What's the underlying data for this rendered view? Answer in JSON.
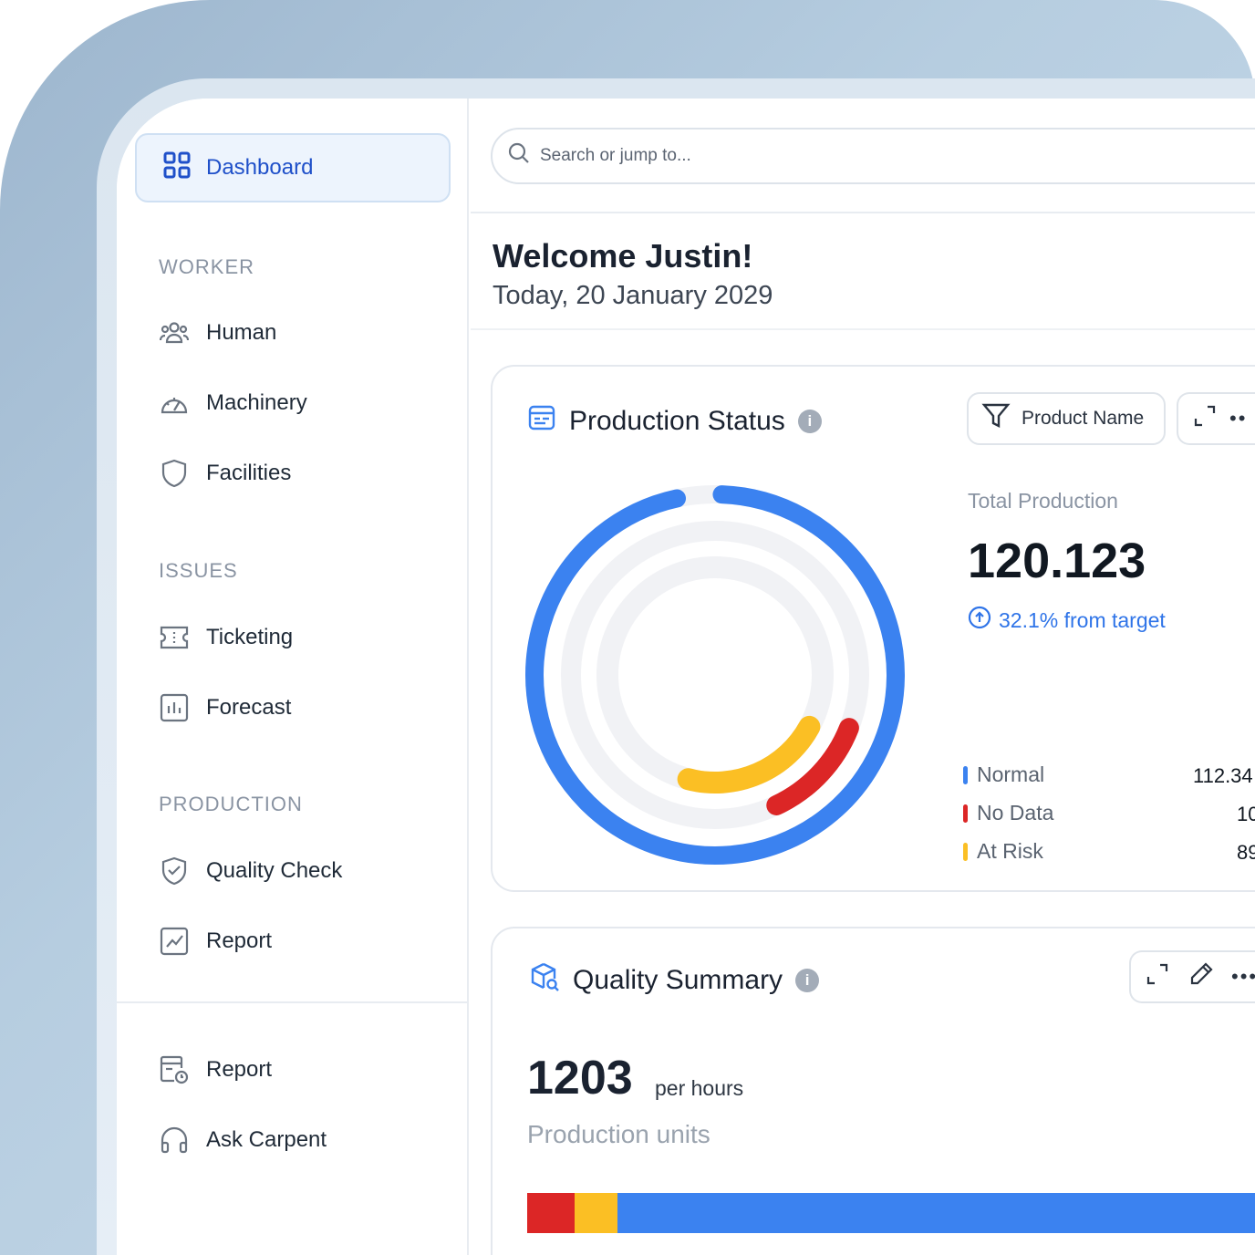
{
  "sidebar": {
    "dashboard_label": "Dashboard",
    "sections": [
      {
        "label": "WORKER",
        "items": [
          "Human",
          "Machinery",
          "Facilities"
        ]
      },
      {
        "label": "ISSUES",
        "items": [
          "Ticketing",
          "Forecast"
        ]
      },
      {
        "label": "PRODUCTION",
        "items": [
          "Quality Check",
          "Report"
        ]
      }
    ],
    "footer_items": [
      "Report",
      "Ask Carpent"
    ]
  },
  "search": {
    "placeholder": "Search or jump to..."
  },
  "header": {
    "welcome": "Welcome Justin!",
    "date": "Today, 20 January 2029"
  },
  "production_status": {
    "title": "Production Status",
    "filter_label": "Product Name",
    "total_label": "Total Production",
    "total_value": "120.123",
    "trend_text": "32.1% from target",
    "legend": [
      {
        "name": "Normal",
        "value": "112.34",
        "color": "#3b82f0"
      },
      {
        "name": "No Data",
        "value": "10",
        "color": "#dc2626"
      },
      {
        "name": "At Risk",
        "value": "89",
        "color": "#fbbf24"
      }
    ],
    "rings": [
      {
        "name": "Normal",
        "fraction": 0.96,
        "color": "#3b82f0"
      },
      {
        "name": "No Data",
        "fraction": 0.12,
        "color": "#dc2626"
      },
      {
        "name": "At Risk",
        "fraction": 0.21,
        "color": "#fbbf24"
      }
    ],
    "track_color": "#f1f2f5"
  },
  "quality_summary": {
    "title": "Quality Summary",
    "value": "1203",
    "unit": "per hours",
    "label": "Production units",
    "bar": [
      {
        "name": "No Data",
        "fraction": 0.06,
        "color": "#dc2626"
      },
      {
        "name": "At Risk",
        "fraction": 0.055,
        "color": "#fbbf24"
      },
      {
        "name": "Normal",
        "fraction": 0.885,
        "color": "#3b82f0"
      }
    ]
  }
}
